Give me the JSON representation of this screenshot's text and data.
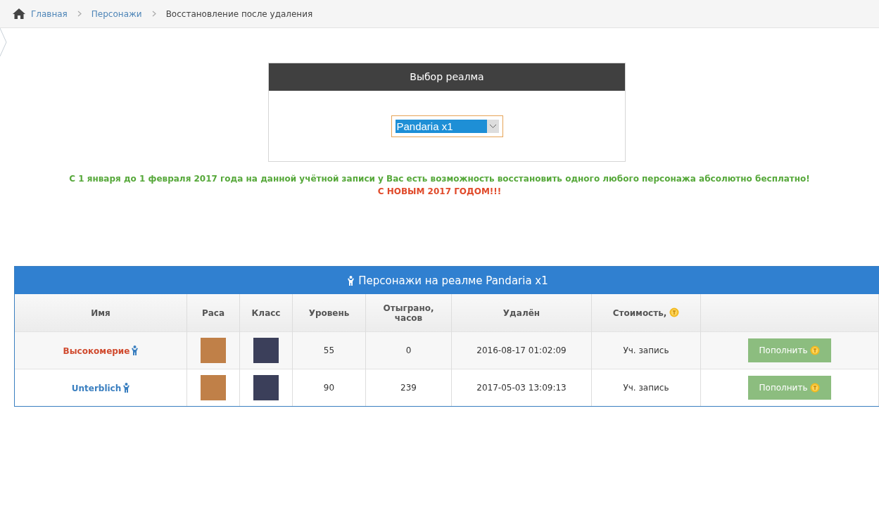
{
  "breadcrumbs": [
    {
      "label": "Главная",
      "link": true
    },
    {
      "label": "Персонажи",
      "link": true
    },
    {
      "label": "Восстановление после удаления",
      "link": false
    }
  ],
  "realm_panel": {
    "title": "Выбор реалма",
    "select": {
      "value": "Pandaria x1"
    }
  },
  "notice": {
    "message": "С 1 января до 1 февраля 2017 года на данной учётной записи у Вас есть возможность восстановить одного любого персонажа абсолютно бесплатно!",
    "greeting": "С НОВЫМ 2017 ГОДОМ!!!"
  },
  "characters_table": {
    "title": "Персонажи на реалме Pandaria x1",
    "columns": [
      "Имя",
      "Раса",
      "Класс",
      "Уровень",
      "Отыграно, часов",
      "Удалён",
      "Стоимость,"
    ],
    "rows": [
      {
        "name": "Высокомерие",
        "color": "#d04a2e",
        "level": "55",
        "played": "0",
        "deleted": "2016-08-17 01:02:09",
        "cost": "Уч. запись",
        "action": "Пополнить"
      },
      {
        "name": "Unterblich",
        "color": "#3a7fc0",
        "level": "90",
        "played": "239",
        "deleted": "2017-05-03 13:09:13",
        "cost": "Уч. запись",
        "action": "Пополнить"
      }
    ]
  }
}
